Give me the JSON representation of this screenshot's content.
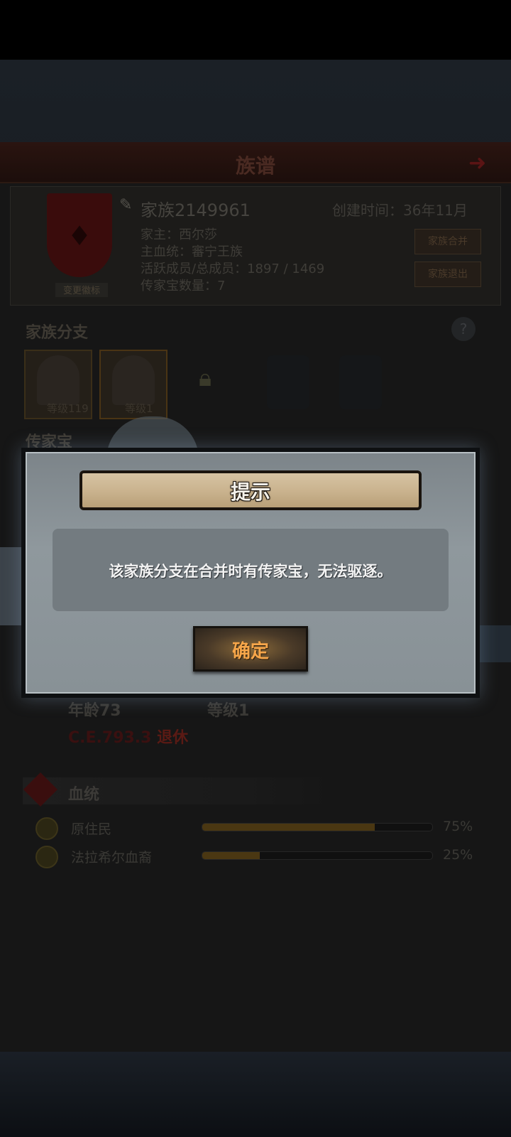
{
  "header": {
    "title": "族谱"
  },
  "family": {
    "name": "家族2149961",
    "created": "创建时间：36年11月",
    "head": "家主：西尔莎",
    "main_blood": "主血统：審宁王族",
    "active_total": "活跃成员/总成员：1897 / 1469",
    "heirloom_count": "传家宝数量：7",
    "crest_button": "变更徽标",
    "merge_button": "家族合并",
    "quit_button": "家族退出"
  },
  "branches": {
    "label": "家族分支",
    "items": [
      {
        "level": "等级119"
      },
      {
        "level": "等级1"
      }
    ]
  },
  "heirloom_label": "传家宝",
  "member": {
    "age": "年龄73",
    "level": "等级1",
    "era": "C.E.793.3",
    "status": "退休"
  },
  "bloodline": {
    "label": "血统",
    "rows": [
      {
        "name": "原住民",
        "pct": "75%",
        "value": 0.75
      },
      {
        "name": "法拉希尔血裔",
        "pct": "25%",
        "value": 0.25
      }
    ]
  },
  "dialog": {
    "title": "提示",
    "message": "该家族分支在合并时有传家宝，无法驱逐。",
    "ok": "确定"
  }
}
